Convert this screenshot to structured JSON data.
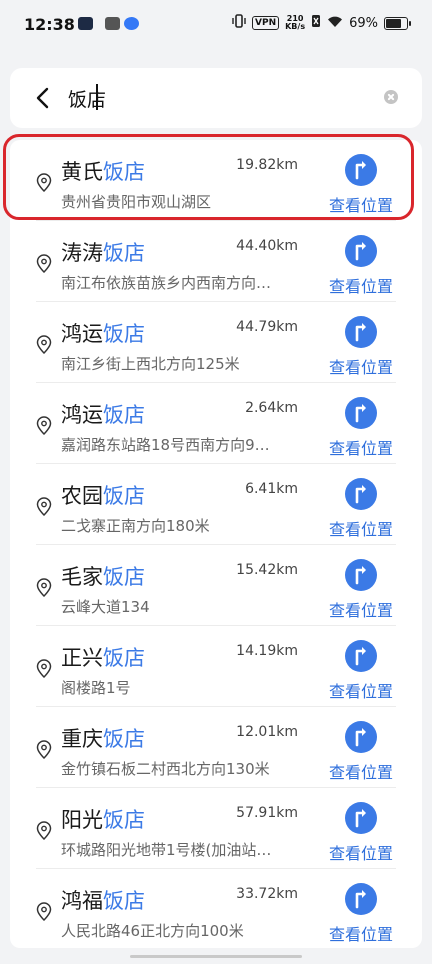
{
  "status_bar": {
    "time": "12:38",
    "vpn": "VPN",
    "speed_value": "210",
    "speed_unit": "KB/s",
    "battery": "69%"
  },
  "search": {
    "query": "饭店",
    "placeholder": ""
  },
  "results": [
    {
      "prefix": "黄氏",
      "keyword": "饭店",
      "distance": "19.82km",
      "address": "贵州省贵阳市观山湖区",
      "action": "查看位置"
    },
    {
      "prefix": "涛涛",
      "keyword": "饭店",
      "distance": "44.40km",
      "address": "南江布依族苗族乡内西南方向…",
      "action": "查看位置"
    },
    {
      "prefix": "鸿运",
      "keyword": "饭店",
      "distance": "44.79km",
      "address": "南江乡街上西北方向125米",
      "action": "查看位置"
    },
    {
      "prefix": "鸿运",
      "keyword": "饭店",
      "distance": "2.64km",
      "address": "嘉润路东站路18号西南方向9…",
      "action": "查看位置"
    },
    {
      "prefix": "农园",
      "keyword": "饭店",
      "distance": "6.41km",
      "address": "二戈寨正南方向180米",
      "action": "查看位置"
    },
    {
      "prefix": "毛家",
      "keyword": "饭店",
      "distance": "15.42km",
      "address": "云峰大道134",
      "action": "查看位置"
    },
    {
      "prefix": "正兴",
      "keyword": "饭店",
      "distance": "14.19km",
      "address": "阁楼路1号",
      "action": "查看位置"
    },
    {
      "prefix": "重庆",
      "keyword": "饭店",
      "distance": "12.01km",
      "address": "金竹镇石板二村西北方向130米",
      "action": "查看位置"
    },
    {
      "prefix": "阳光",
      "keyword": "饭店",
      "distance": "57.91km",
      "address": "环城路阳光地带1号楼(加油站…",
      "action": "查看位置"
    },
    {
      "prefix": "鸿福",
      "keyword": "饭店",
      "distance": "33.72km",
      "address": "人民北路46正北方向100米",
      "action": "查看位置"
    }
  ],
  "colors": {
    "accent": "#3b7ae6",
    "highlight_border": "#d9262c"
  }
}
